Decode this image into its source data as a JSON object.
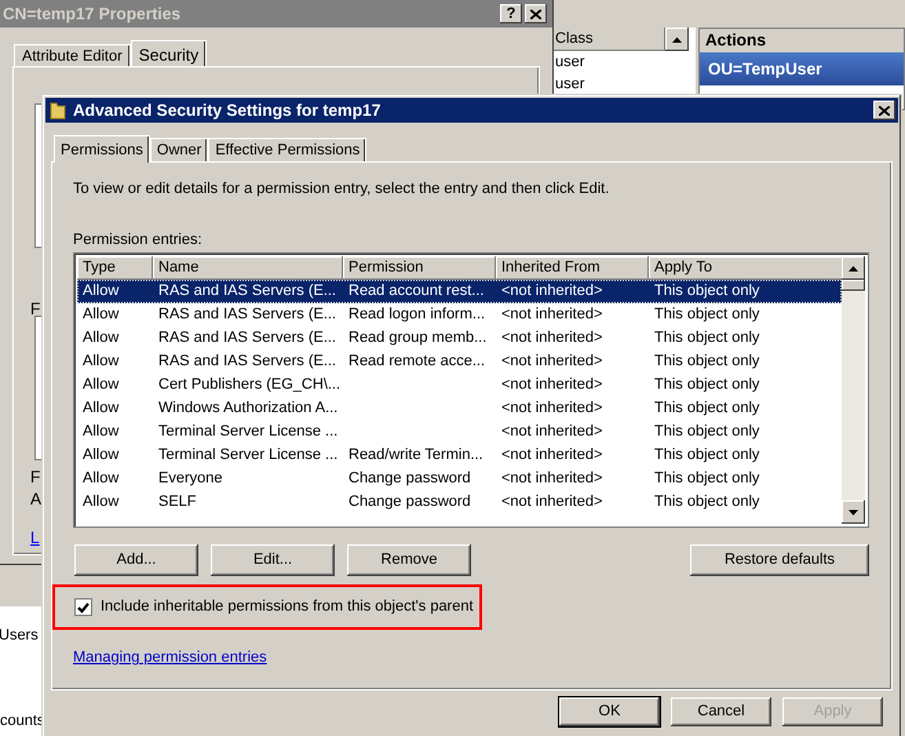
{
  "background": {
    "properties_window": {
      "title": "CN=temp17 Properties",
      "help_button": "?",
      "tabs": [
        {
          "label": "Attribute Editor",
          "selected": false
        },
        {
          "label": "Security",
          "selected": true
        }
      ],
      "edge_labels": [
        {
          "text": "F",
          "kind": "label"
        },
        {
          "text": "F",
          "kind": "label"
        },
        {
          "text": "A",
          "kind": "label"
        },
        {
          "text": "L",
          "kind": "link"
        }
      ]
    },
    "list": {
      "column": "Class",
      "rows": [
        "user",
        "user"
      ]
    },
    "actions": {
      "title": "Actions",
      "selected_item": "OU=TempUser"
    },
    "tree_items": [
      "Users",
      "counts"
    ]
  },
  "dialog": {
    "title": "Advanced Security Settings for temp17",
    "tabs": [
      {
        "label": "Permissions",
        "selected": true
      },
      {
        "label": "Owner",
        "selected": false
      },
      {
        "label": "Effective Permissions",
        "selected": false
      }
    ],
    "description": "To view or edit details for a permission entry, select the entry and then click Edit.",
    "entries_label": "Permission entries:",
    "columns": [
      "Type",
      "Name",
      "Permission",
      "Inherited From",
      "Apply To"
    ],
    "rows": [
      {
        "type": "Allow",
        "name": "RAS and IAS Servers (E...",
        "permission": "Read account rest...",
        "inherited_from": "<not inherited>",
        "apply_to": "This object only",
        "selected": true
      },
      {
        "type": "Allow",
        "name": "RAS and IAS Servers (E...",
        "permission": "Read logon inform...",
        "inherited_from": "<not inherited>",
        "apply_to": "This object only",
        "selected": false
      },
      {
        "type": "Allow",
        "name": "RAS and IAS Servers (E...",
        "permission": "Read group memb...",
        "inherited_from": "<not inherited>",
        "apply_to": "This object only",
        "selected": false
      },
      {
        "type": "Allow",
        "name": "RAS and IAS Servers (E...",
        "permission": "Read remote acce...",
        "inherited_from": "<not inherited>",
        "apply_to": "This object only",
        "selected": false
      },
      {
        "type": "Allow",
        "name": "Cert Publishers (EG_CH\\...",
        "inherited_from": "<not inherited>",
        "apply_to": "This object only",
        "selected": false
      },
      {
        "type": "Allow",
        "name": "Windows Authorization A...",
        "inherited_from": "<not inherited>",
        "apply_to": "This object only",
        "selected": false
      },
      {
        "type": "Allow",
        "name": "Terminal Server License ...",
        "inherited_from": "<not inherited>",
        "apply_to": "This object only",
        "selected": false
      },
      {
        "type": "Allow",
        "name": "Terminal Server License ...",
        "permission": "Read/write Termin...",
        "inherited_from": "<not inherited>",
        "apply_to": "This object only",
        "selected": false
      },
      {
        "type": "Allow",
        "name": "Everyone",
        "permission": "Change password",
        "inherited_from": "<not inherited>",
        "apply_to": "This object only",
        "selected": false
      },
      {
        "type": "Allow",
        "name": "SELF",
        "permission": "Change password",
        "inherited_from": "<not inherited>",
        "apply_to": "This object only",
        "selected": false
      }
    ],
    "entry_buttons": [
      "Add...",
      "Edit...",
      "Remove"
    ],
    "restore_button": "Restore defaults",
    "inherit_checkbox": {
      "label": "Include inheritable permissions from this object's parent",
      "checked": true,
      "highlighted": true
    },
    "help_link": "Managing permission entries",
    "footer_buttons": [
      {
        "label": "OK",
        "disabled": false,
        "default": true
      },
      {
        "label": "Cancel",
        "disabled": false,
        "default": false
      },
      {
        "label": "Apply",
        "disabled": true,
        "default": false
      }
    ]
  }
}
